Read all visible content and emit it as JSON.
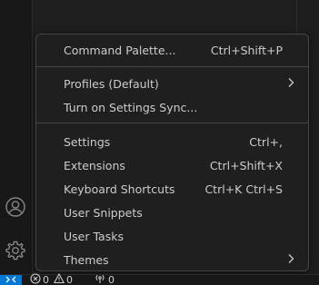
{
  "menu": {
    "items": [
      {
        "label": "Command Palette...",
        "shortcut": "Ctrl+Shift+P"
      },
      {
        "label": "Profiles (Default)",
        "has_submenu": true
      },
      {
        "label": "Turn on Settings Sync..."
      },
      {
        "label": "Settings",
        "shortcut": "Ctrl+,"
      },
      {
        "label": "Extensions",
        "shortcut": "Ctrl+Shift+X"
      },
      {
        "label": "Keyboard Shortcuts",
        "shortcut": "Ctrl+K Ctrl+S"
      },
      {
        "label": "User Snippets"
      },
      {
        "label": "User Tasks"
      },
      {
        "label": "Themes",
        "has_submenu": true
      }
    ]
  },
  "activity_bar": {
    "icons": [
      "account-icon",
      "manage-gear-icon"
    ]
  },
  "status_bar": {
    "errors": "0",
    "warnings": "0",
    "ports": "0",
    "icons": [
      "remote-icon",
      "error-icon",
      "warning-icon",
      "ports-icon"
    ]
  },
  "colors": {
    "background": "#1e1e1e",
    "menu_background": "#1f1f1f",
    "menu_border": "#454545",
    "text": "#cccccc",
    "remote_accent": "#0078d4"
  }
}
